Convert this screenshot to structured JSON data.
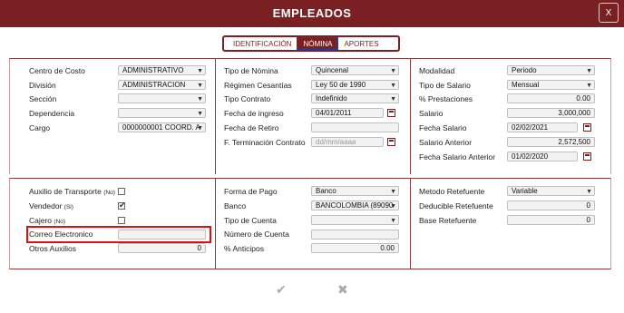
{
  "title": "EMPLEADOS",
  "close_label": "X",
  "tabs": [
    {
      "label": "IDENTIFICACIÓN"
    },
    {
      "label": "NÓMINA"
    },
    {
      "label": "APORTES"
    }
  ],
  "top": {
    "col1": [
      {
        "label": "Centro de Costo",
        "value": "ADMINISTRATIVO"
      },
      {
        "label": "División",
        "value": "ADMINISTRACION"
      },
      {
        "label": "Sección",
        "value": ""
      },
      {
        "label": "Dependencia",
        "value": ""
      },
      {
        "label": "Cargo",
        "value": "0000000001 COORD. A"
      }
    ],
    "col2": [
      {
        "label": "Tipo de Nómina",
        "value": "Quincenal"
      },
      {
        "label": "Régimen Cesantías",
        "value": "Ley 50 de 1990"
      },
      {
        "label": "Tipo Contrato",
        "value": "Indefinido"
      },
      {
        "label": "Fecha de ingreso",
        "value": "04/01/2011"
      },
      {
        "label": "Fecha de Retiro",
        "value": ""
      },
      {
        "label": "F. Terminación Contrato",
        "value": "",
        "placeholder": "dd/mm/aaaa"
      }
    ],
    "col3": [
      {
        "label": "Modalidad",
        "value": "Periodo"
      },
      {
        "label": "Tipo de Salario",
        "value": "Mensual"
      },
      {
        "label": "% Prestaciones",
        "value": "0.00"
      },
      {
        "label": "Salario",
        "value": "3,000,000"
      },
      {
        "label": "Fecha Salario",
        "value": "02/02/2021"
      },
      {
        "label": "Salario Anterior",
        "value": "2,572,500"
      },
      {
        "label": "Fecha Salario Anterior",
        "value": "01/02/2020"
      }
    ]
  },
  "bottom": {
    "col1": [
      {
        "label": "Auxilio de Transporte",
        "sub": "(No)",
        "checked": false
      },
      {
        "label": "Vendedor",
        "sub": "(Si)",
        "checked": true
      },
      {
        "label": "Cajero",
        "sub": "(No)",
        "checked": false
      },
      {
        "label": "Correo Electronico",
        "value": ""
      },
      {
        "label": "Otros Auxilios",
        "value": "0"
      }
    ],
    "col2": [
      {
        "label": "Forma de Pago",
        "value": "Banco"
      },
      {
        "label": "Banco",
        "value": "BANCOLOMBIA (89090"
      },
      {
        "label": "Tipo de Cuenta",
        "value": ""
      },
      {
        "label": "Número de Cuenta",
        "value": ""
      },
      {
        "label": "% Anticipos",
        "value": "0.00"
      }
    ],
    "col3": [
      {
        "label": "Metodo Retefuente",
        "value": "Variable"
      },
      {
        "label": "Deducible Retefuente",
        "value": "0"
      },
      {
        "label": "Base Retefuente",
        "value": "0"
      }
    ]
  },
  "actions": {
    "save_icon": "✔",
    "cancel_icon": "✖"
  },
  "colors": {
    "brand": "#7a1f22",
    "highlight": "#e01010"
  }
}
